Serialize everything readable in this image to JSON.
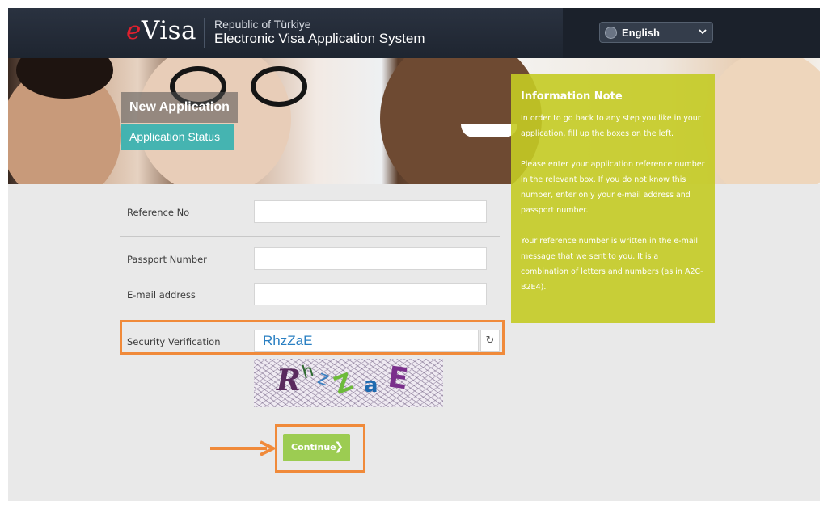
{
  "header": {
    "logo_e": "e",
    "logo_rest": "Visa",
    "subtitle": "Republic of Türkiye",
    "title": "Electronic Visa Application System",
    "language": "English"
  },
  "tabs": {
    "new_application": "New Application",
    "application_status": "Application Status"
  },
  "info_note": {
    "title": "Information Note",
    "paragraphs": [
      "In order to go back to any step you like in your application, fill up the boxes on the left.",
      "Please enter your application reference number in the relevant box. If you do not know this number, enter only your e-mail address and passport number.",
      "Your reference number is written in the e-mail message that we sent to you. It is a combination of letters and numbers (as in A2C-B2E4)."
    ]
  },
  "form": {
    "reference_label": "Reference No",
    "reference_value": "",
    "passport_label": "Passport Number",
    "passport_value": "",
    "email_label": "E-mail address",
    "email_value": "",
    "security_label": "Security Verification",
    "security_value": "RhzZaE",
    "captcha_text": [
      "R",
      "h",
      "z",
      "Z",
      "a",
      "E"
    ],
    "continue_label": "Continue"
  },
  "colors": {
    "accent_orange": "#f08a3a",
    "continue_green": "#9ccc52",
    "info_yellow": "#c4cb24",
    "status_teal": "#28afaf",
    "logo_red": "#e0202e"
  }
}
